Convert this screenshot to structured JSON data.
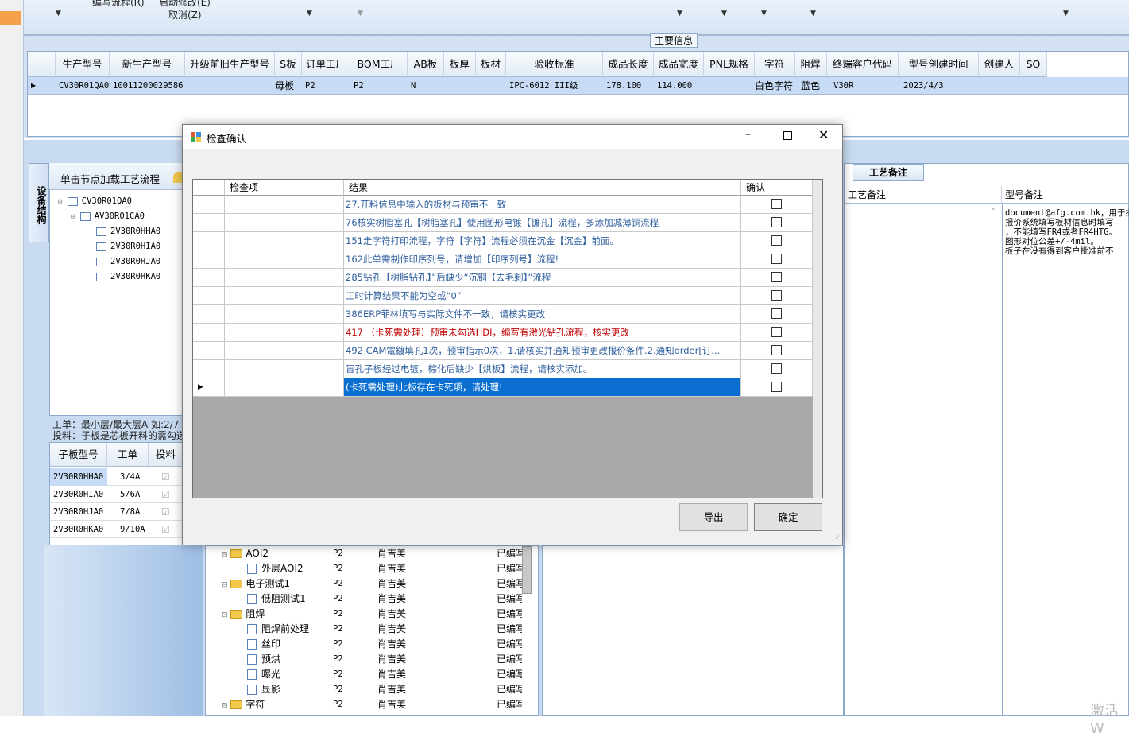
{
  "top_bar": {
    "label1": "编写流程(R)",
    "label2": "启动修改(E)",
    "label3": "取消(Z)"
  },
  "main_info": {
    "group_title": "主要信息",
    "columns": [
      "生产型号",
      "新生产型号",
      "升级前旧生产型号",
      "S板",
      "订单工厂",
      "BOM工厂",
      "AB板",
      "板厚",
      "板材",
      "验收标准",
      "成品长度",
      "成品宽度",
      "PNL规格",
      "字符",
      "阻焊",
      "终端客户代码",
      "型号创建时间",
      "创建人",
      "SO"
    ],
    "row": [
      "CV30R01QA0",
      "10011200029586",
      "",
      "母板",
      "P2",
      "P2",
      "N",
      "",
      "",
      "IPC-6012 III级",
      "178.100",
      "114.000",
      "",
      "白色字符",
      "蓝色",
      "V30R",
      "2023/4/3",
      "",
      ""
    ]
  },
  "left_tab": "设备结构",
  "tree": {
    "header": "单击节点加载工艺流程",
    "nodes": [
      "CV30R01QA0",
      "AV30R01CA0",
      "2V30R0HHA0",
      "2V30R0HIA0",
      "2V30R0HJA0",
      "2V30R0HKA0"
    ]
  },
  "info": {
    "line1": "工单：最小层/最大层A 如:2/7",
    "line2": "投料：子板是芯板开料的需勾选"
  },
  "sub_grid": {
    "columns": [
      "子板型号",
      "工单",
      "投料"
    ],
    "rows": [
      [
        "2V30R0HHA0",
        "3/4A"
      ],
      [
        "2V30R0HIA0",
        "5/6A"
      ],
      [
        "2V30R0HJA0",
        "7/8A"
      ],
      [
        "2V30R0HKA0",
        "9/10A"
      ]
    ]
  },
  "process_tree": {
    "rows": [
      {
        "name": "AOI2",
        "factory": "P2",
        "person": "肖吉美",
        "status": "已编写"
      },
      {
        "name": "外层AOI2",
        "factory": "P2",
        "person": "肖吉美",
        "status": "已编写"
      },
      {
        "name": "电子测试1",
        "factory": "P2",
        "person": "肖吉美",
        "status": "已编写"
      },
      {
        "name": "低阻测试1",
        "factory": "P2",
        "person": "肖吉美",
        "status": "已编写"
      },
      {
        "name": "阻焊",
        "factory": "P2",
        "person": "肖吉美",
        "status": "已编写"
      },
      {
        "name": "阻焊前处理",
        "factory": "P2",
        "person": "肖吉美",
        "status": "已编写"
      },
      {
        "name": "丝印",
        "factory": "P2",
        "person": "肖吉美",
        "status": "已编写"
      },
      {
        "name": "预烘",
        "factory": "P2",
        "person": "肖吉美",
        "status": "已编写"
      },
      {
        "name": "曝光",
        "factory": "P2",
        "person": "肖吉美",
        "status": "已编写"
      },
      {
        "name": "显影",
        "factory": "P2",
        "person": "肖吉美",
        "status": "已编写"
      },
      {
        "name": "字符",
        "factory": "P2",
        "person": "肖吉美",
        "status": "已编写"
      }
    ]
  },
  "remarks": {
    "tab": "工艺备注",
    "col1": "工艺备注",
    "col2": "型号备注",
    "text": [
      "document@afg.com.hk，用于接",
      "报价系统填写板材信息时填写",
      "，不能填写FR4或者FR4HTG。",
      "图形对位公差+/-4mil。",
      "板子在没有得到客户批准前不"
    ]
  },
  "dialog": {
    "title": "检查确认",
    "columns": [
      "检查项",
      "结果",
      "确认"
    ],
    "rows": [
      {
        "result": "27.开料信息中输入的板材与预审不一致",
        "color": "#2f5f9e"
      },
      {
        "result": "76核实树脂塞孔【树脂塞孔】使用图形电镀【镀孔】流程，多添加减薄铜流程",
        "color": "#2f5f9e"
      },
      {
        "result": "151走字符打印流程，字符【字符】流程必须在沉金【沉金】前面。",
        "color": "#2f5f9e"
      },
      {
        "result": "162此单需制作印序列号，请增加【印序列号】流程!",
        "color": "#2f5f9e"
      },
      {
        "result": "285钻孔【树脂钻孔】”后缺少“沉铜【去毛刺】”流程",
        "color": "#2f5f9e"
      },
      {
        "result": "工时计算结果不能为空或“0”",
        "color": "#2f5f9e"
      },
      {
        "result": "386ERP菲林填写与实际文件不一致，请核实更改",
        "color": "#2f5f9e"
      },
      {
        "result": "417 （卡死需处理）预审未勾选HDI，编写有激光钻孔流程，核实更改",
        "color": "#c00000"
      },
      {
        "result": "492 CAM電鍍填孔1次，预审指示0次，1.请核实并通知预审更改报价条件.2.通知order[订...",
        "color": "#2f5f9e"
      },
      {
        "result": "盲孔子板经过电镀，棕化后缺少【烘板】流程，请核实添加。",
        "color": "#2f5f9e"
      },
      {
        "result": "(卡死需处理)此板存在卡死项，请处理!",
        "color": "#ffffff"
      }
    ],
    "export_label": "导出",
    "ok_label": "确定"
  },
  "watermark": "激活 W"
}
